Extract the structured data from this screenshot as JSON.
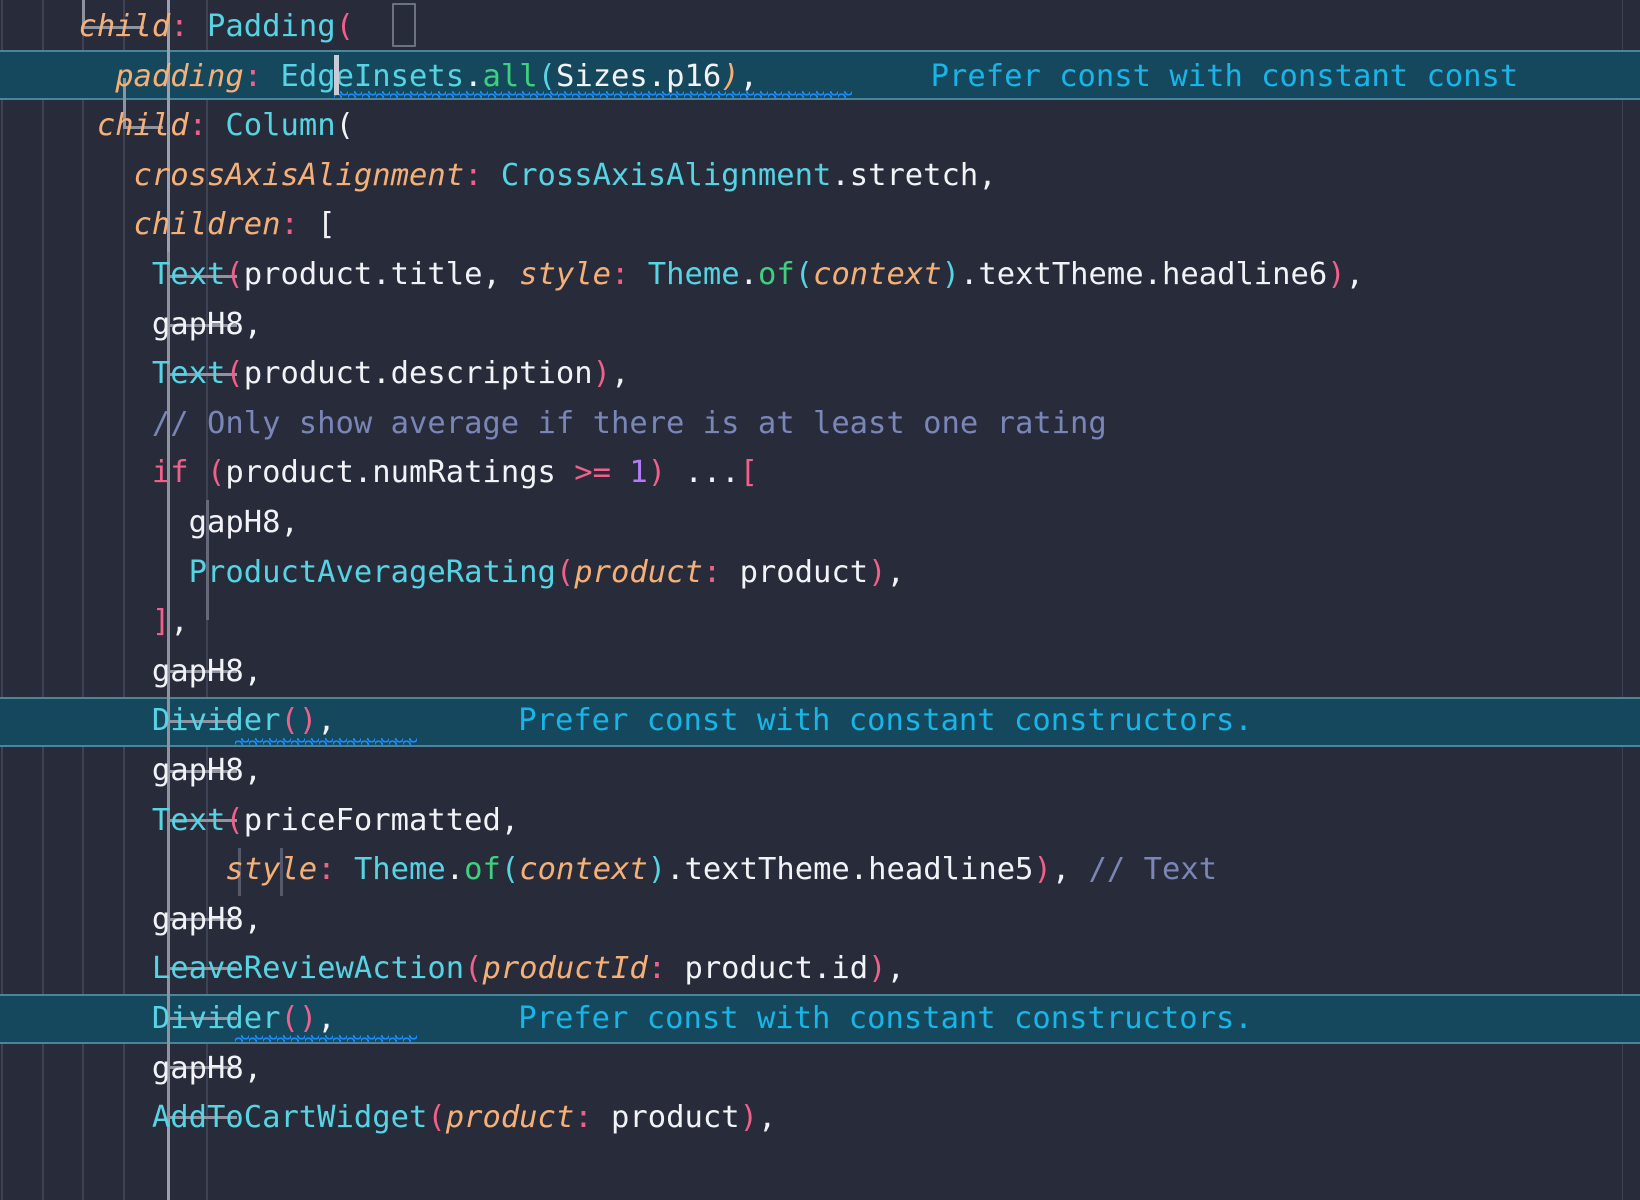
{
  "editor": {
    "language": "Dart",
    "colors": {
      "background": "#282c3a",
      "lint_line_background": "#15485c",
      "lint_line_border": "#4c8599",
      "indent_guide": "#3d4354",
      "indent_guide_active": "#9aa0b0",
      "widget_guide": "#8e939f",
      "ruler": "#3a4052",
      "class_name": "#56d4e4",
      "punctuation": "#f0608a",
      "identifier": "#f2f3f7",
      "named_parameter": "#f5b078",
      "keyword": "#f0608a",
      "method": "#3fd07f",
      "number": "#b27cf5",
      "comment": "#7a85b8",
      "lint_text": "#19b5e8",
      "squiggle": "#1a8cff",
      "caret": "#c8ccd6"
    },
    "lint_message": "Prefer const with constant constructors.",
    "lint_message_truncated": "Prefer const with constant const",
    "lines": [
      {
        "n": 0,
        "text": "    └─child: Padding(",
        "tokens": [
          {
            "t": "    ",
            "c": "plain"
          },
          {
            "t": "child",
            "c": "param"
          },
          {
            "t": ":",
            "c": "colon"
          },
          {
            "t": " ",
            "c": "plain"
          },
          {
            "t": "Padding",
            "c": "cls"
          },
          {
            "t": "(",
            "c": "punc"
          }
        ]
      },
      {
        "n": 1,
        "text": "      padding: EdgeInsets.all(Sizes.p16),",
        "lint": true,
        "tokens": [
          {
            "t": "      ",
            "c": "plain"
          },
          {
            "t": "padding",
            "c": "param"
          },
          {
            "t": ":",
            "c": "colon"
          },
          {
            "t": " ",
            "c": "plain"
          },
          {
            "t": "EdgeInsets",
            "c": "cls"
          },
          {
            "t": ".",
            "c": "plain"
          },
          {
            "t": "all",
            "c": "meth"
          },
          {
            "t": "(",
            "c": "cls"
          },
          {
            "t": "Sizes",
            "c": "plain"
          },
          {
            "t": ".",
            "c": "plain"
          },
          {
            "t": "p16",
            "c": "plain"
          },
          {
            "t": ")",
            "c": "param"
          },
          {
            "t": ",",
            "c": "plain"
          }
        ]
      },
      {
        "n": 2,
        "text": "     └─child: Column(",
        "tokens": [
          {
            "t": "     ",
            "c": "plain"
          },
          {
            "t": "child",
            "c": "param"
          },
          {
            "t": ":",
            "c": "colon"
          },
          {
            "t": " ",
            "c": "plain"
          },
          {
            "t": "Column",
            "c": "cls"
          },
          {
            "t": "(",
            "c": "plain"
          }
        ]
      },
      {
        "n": 3,
        "text": "       crossAxisAlignment: CrossAxisAlignment.stretch,",
        "tokens": [
          {
            "t": "       ",
            "c": "plain"
          },
          {
            "t": "crossAxisAlignment",
            "c": "param"
          },
          {
            "t": ":",
            "c": "colon"
          },
          {
            "t": " ",
            "c": "plain"
          },
          {
            "t": "CrossAxisAlignment",
            "c": "cls"
          },
          {
            "t": ".stretch,",
            "c": "plain"
          }
        ]
      },
      {
        "n": 4,
        "text": "       children: [",
        "tokens": [
          {
            "t": "       ",
            "c": "plain"
          },
          {
            "t": "children",
            "c": "param"
          },
          {
            "t": ":",
            "c": "colon"
          },
          {
            "t": " [",
            "c": "plain"
          }
        ]
      },
      {
        "n": 5,
        "text": "        Text(product.title, style: Theme.of(context).textTheme.headline6),",
        "tokens": [
          {
            "t": "        ",
            "c": "plain"
          },
          {
            "t": "Text",
            "c": "cls"
          },
          {
            "t": "(",
            "c": "punc"
          },
          {
            "t": "product.title, ",
            "c": "plain"
          },
          {
            "t": "style",
            "c": "param"
          },
          {
            "t": ":",
            "c": "colon"
          },
          {
            "t": " ",
            "c": "plain"
          },
          {
            "t": "Theme",
            "c": "cls"
          },
          {
            "t": ".",
            "c": "plain"
          },
          {
            "t": "of",
            "c": "meth"
          },
          {
            "t": "(",
            "c": "cls"
          },
          {
            "t": "context",
            "c": "param"
          },
          {
            "t": ")",
            "c": "cls"
          },
          {
            "t": ".textTheme.headline6",
            "c": "plain"
          },
          {
            "t": ")",
            "c": "punc"
          },
          {
            "t": ",",
            "c": "plain"
          }
        ]
      },
      {
        "n": 6,
        "text": "        gapH8,",
        "tokens": [
          {
            "t": "        gapH8,",
            "c": "plain"
          }
        ]
      },
      {
        "n": 7,
        "text": "        Text(product.description),",
        "tokens": [
          {
            "t": "        ",
            "c": "plain"
          },
          {
            "t": "Text",
            "c": "cls"
          },
          {
            "t": "(",
            "c": "punc"
          },
          {
            "t": "product.description",
            "c": "plain"
          },
          {
            "t": ")",
            "c": "punc"
          },
          {
            "t": ",",
            "c": "plain"
          }
        ]
      },
      {
        "n": 8,
        "text": "        // Only show average if there is at least one rating",
        "tokens": [
          {
            "t": "        ",
            "c": "plain"
          },
          {
            "t": "// Only show average if there is at least one rating",
            "c": "cmt"
          }
        ]
      },
      {
        "n": 9,
        "text": "        if (product.numRatings >= 1) ...[",
        "tokens": [
          {
            "t": "        ",
            "c": "plain"
          },
          {
            "t": "if",
            "c": "kw"
          },
          {
            "t": " ",
            "c": "plain"
          },
          {
            "t": "(",
            "c": "punc"
          },
          {
            "t": "product.numRatings ",
            "c": "plain"
          },
          {
            "t": ">=",
            "c": "op"
          },
          {
            "t": " ",
            "c": "plain"
          },
          {
            "t": "1",
            "c": "num"
          },
          {
            "t": ")",
            "c": "punc"
          },
          {
            "t": " ",
            "c": "plain"
          },
          {
            "t": "...",
            "c": "dots"
          },
          {
            "t": "[",
            "c": "punc"
          }
        ]
      },
      {
        "n": 10,
        "text": "          gapH8,",
        "tokens": [
          {
            "t": "          gapH8,",
            "c": "plain"
          }
        ]
      },
      {
        "n": 11,
        "text": "          ProductAverageRating(product: product),",
        "tokens": [
          {
            "t": "          ",
            "c": "plain"
          },
          {
            "t": "ProductAverageRating",
            "c": "cls"
          },
          {
            "t": "(",
            "c": "punc"
          },
          {
            "t": "product",
            "c": "param"
          },
          {
            "t": ":",
            "c": "colon"
          },
          {
            "t": " product",
            "c": "plain"
          },
          {
            "t": ")",
            "c": "punc"
          },
          {
            "t": ",",
            "c": "plain"
          }
        ]
      },
      {
        "n": 12,
        "text": "        ],",
        "tokens": [
          {
            "t": "        ",
            "c": "plain"
          },
          {
            "t": "]",
            "c": "punc"
          },
          {
            "t": ",",
            "c": "plain"
          }
        ]
      },
      {
        "n": 13,
        "text": "        gapH8,",
        "tokens": [
          {
            "t": "        gapH8,",
            "c": "plain"
          }
        ]
      },
      {
        "n": 14,
        "text": "        Divider(),",
        "lint": true,
        "lintInline": "Prefer const with constant constructors.",
        "tokens": [
          {
            "t": "        ",
            "c": "plain"
          },
          {
            "t": "Divider",
            "c": "cls"
          },
          {
            "t": "(",
            "c": "punc"
          },
          {
            "t": ")",
            "c": "punc"
          },
          {
            "t": ",",
            "c": "plain"
          }
        ]
      },
      {
        "n": 15,
        "text": "        gapH8,",
        "tokens": [
          {
            "t": "        gapH8,",
            "c": "plain"
          }
        ]
      },
      {
        "n": 16,
        "text": "        Text(priceFormatted,",
        "tokens": [
          {
            "t": "        ",
            "c": "plain"
          },
          {
            "t": "Text",
            "c": "cls"
          },
          {
            "t": "(",
            "c": "punc"
          },
          {
            "t": "priceFormatted,",
            "c": "plain"
          }
        ]
      },
      {
        "n": 17,
        "text": "            style: Theme.of(context).textTheme.headline5), // Text",
        "tokens": [
          {
            "t": "            ",
            "c": "plain"
          },
          {
            "t": "style",
            "c": "param"
          },
          {
            "t": ":",
            "c": "colon"
          },
          {
            "t": " ",
            "c": "plain"
          },
          {
            "t": "Theme",
            "c": "cls"
          },
          {
            "t": ".",
            "c": "plain"
          },
          {
            "t": "of",
            "c": "meth"
          },
          {
            "t": "(",
            "c": "cls"
          },
          {
            "t": "context",
            "c": "param"
          },
          {
            "t": ")",
            "c": "cls"
          },
          {
            "t": ".textTheme.headline5",
            "c": "plain"
          },
          {
            "t": ")",
            "c": "punc"
          },
          {
            "t": ", ",
            "c": "plain"
          },
          {
            "t": "// Text",
            "c": "cmt"
          }
        ]
      },
      {
        "n": 18,
        "text": "        gapH8,",
        "tokens": [
          {
            "t": "        gapH8,",
            "c": "plain"
          }
        ]
      },
      {
        "n": 19,
        "text": "        LeaveReviewAction(productId: product.id),",
        "tokens": [
          {
            "t": "        ",
            "c": "plain"
          },
          {
            "t": "LeaveReviewAction",
            "c": "cls"
          },
          {
            "t": "(",
            "c": "punc"
          },
          {
            "t": "productId",
            "c": "param"
          },
          {
            "t": ":",
            "c": "colon"
          },
          {
            "t": " product.id",
            "c": "plain"
          },
          {
            "t": ")",
            "c": "punc"
          },
          {
            "t": ",",
            "c": "plain"
          }
        ]
      },
      {
        "n": 20,
        "text": "        Divider(),",
        "lint": true,
        "lintInline": "Prefer const with constant constructors.",
        "tokens": [
          {
            "t": "        ",
            "c": "plain"
          },
          {
            "t": "Divider",
            "c": "cls"
          },
          {
            "t": "(",
            "c": "punc"
          },
          {
            "t": ")",
            "c": "punc"
          },
          {
            "t": ",",
            "c": "plain"
          }
        ]
      },
      {
        "n": 21,
        "text": "        gapH8,",
        "tokens": [
          {
            "t": "        gapH8,",
            "c": "plain"
          }
        ]
      },
      {
        "n": 22,
        "text": "        AddToCartWidget(product: product),",
        "tokens": [
          {
            "t": "        ",
            "c": "plain"
          },
          {
            "t": "AddToCartWidget",
            "c": "cls"
          },
          {
            "t": "(",
            "c": "punc"
          },
          {
            "t": "product",
            "c": "param"
          },
          {
            "t": ":",
            "c": "colon"
          },
          {
            "t": " product",
            "c": "plain"
          },
          {
            "t": ")",
            "c": "punc"
          },
          {
            "t": ",",
            "c": "plain"
          }
        ]
      }
    ]
  }
}
